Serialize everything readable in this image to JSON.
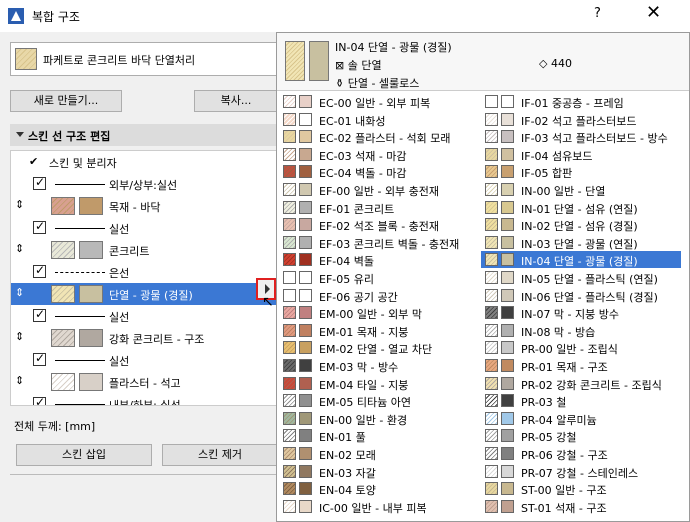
{
  "window": {
    "title": "복합 구조",
    "help": "?",
    "close": "✕"
  },
  "preset": {
    "label": "파케트로 콘크리트 바닥 단열처리"
  },
  "buttons": {
    "new": "새로 만들기...",
    "copy": "복사...",
    "insert_skin": "스킨 삽입",
    "remove_skin": "스킨 제거"
  },
  "editor": {
    "title": "스킨 선 구조 편집",
    "total_thickness": "전체 두께: [mm]"
  },
  "skins": [
    {
      "kind": "header",
      "label": "스킨 및 분리자"
    },
    {
      "kind": "line",
      "label": "외부/상부:실선"
    },
    {
      "kind": "skin",
      "label": "목재 - 바닥",
      "fill": "#d8a090",
      "fill2": "#c09a6a"
    },
    {
      "kind": "line",
      "label": "실선"
    },
    {
      "kind": "skin",
      "label": "콘크리트",
      "fill": "#e8e8d8",
      "fill2": "#b8b8b8"
    },
    {
      "kind": "line",
      "label": "은선",
      "dashed": true
    },
    {
      "kind": "skin",
      "label": "단열 - 광물 (경질)",
      "fill": "#f1e5b5",
      "fill2": "#c8c0a0",
      "selected": true
    },
    {
      "kind": "line",
      "label": "실선"
    },
    {
      "kind": "skin",
      "label": "강화 콘크리트 - 구조",
      "fill": "#e0d8d0",
      "fill2": "#b0a8a0"
    },
    {
      "kind": "line",
      "label": "실선"
    },
    {
      "kind": "skin",
      "label": "플라스터 - 석고",
      "fill": "#ffffff",
      "fill2": "#d8d0c8"
    },
    {
      "kind": "line",
      "label": "내부/하부: 실선"
    }
  ],
  "popup": {
    "current_name": "IN-04 단열 - 광물 (경질)",
    "current_pen": "솔 단열",
    "current_category": "단열 - 셀룰로스",
    "current_number": "440",
    "materials": [
      {
        "col": 0,
        "label": "EC-00 일반 - 외부 피복",
        "c1": "#ffffff",
        "c2": "#e8d0c8"
      },
      {
        "col": 0,
        "label": "EC-01 내화성",
        "c1": "#f4d8c8",
        "c2": "#ffffff"
      },
      {
        "col": 0,
        "label": "EC-02 플라스터 - 석회 모래",
        "c1": "#e8d8a0",
        "c2": "#e0c8a0"
      },
      {
        "col": 0,
        "label": "EC-03 석재 - 마감",
        "c1": "#ffffff",
        "c2": "#c8a890"
      },
      {
        "col": 0,
        "label": "EC-04 벽돌 - 마감",
        "c1": "#c05040",
        "c2": "#a06040"
      },
      {
        "col": 0,
        "label": "EF-00 일반 - 외부 충전재",
        "c1": "#ffffff",
        "c2": "#d0c8b0"
      },
      {
        "col": 0,
        "label": "EF-01 콘크리트",
        "c1": "#f0f0e0",
        "c2": "#b0b0b0"
      },
      {
        "col": 0,
        "label": "EF-02 석조 블록 - 충전재",
        "c1": "#e8c0b0",
        "c2": "#c8a8a0"
      },
      {
        "col": 0,
        "label": "EF-03 콘크리트 벽돌 - 충전재",
        "c1": "#d8e8d0",
        "c2": "#b0b0b0"
      },
      {
        "col": 0,
        "label": "EF-04 벽돌",
        "c1": "#d04030",
        "c2": "#a03020"
      },
      {
        "col": 0,
        "label": "EF-05 유리",
        "c1": "#ffffff",
        "c2": "#ffffff"
      },
      {
        "col": 0,
        "label": "EF-06 공기 공간",
        "c1": "#ffffff",
        "c2": "#ffffff"
      },
      {
        "col": 0,
        "label": "EM-00 일반 - 외부 막",
        "c1": "#e8a8a0",
        "c2": "#c08080"
      },
      {
        "col": 0,
        "label": "EM-01 목재 - 지붕",
        "c1": "#e09a80",
        "c2": "#c08060"
      },
      {
        "col": 0,
        "label": "EM-02 단열 - 열교 차단",
        "c1": "#e8c070",
        "c2": "#c8a060"
      },
      {
        "col": 0,
        "label": "EM-03 막 - 방수",
        "c1": "#6a6a6a",
        "c2": "#404040"
      },
      {
        "col": 0,
        "label": "EM-04 타일 - 지붕",
        "c1": "#c84838",
        "c2": "#b06050"
      },
      {
        "col": 0,
        "label": "EM-05 티타늄 아연",
        "c1": "#ffffff",
        "c2": "#909090"
      },
      {
        "col": 0,
        "label": "EN-00 일반 - 환경",
        "c1": "#a0b8a0",
        "c2": "#a09878"
      },
      {
        "col": 0,
        "label": "EN-01 풀",
        "c1": "#ffffff",
        "c2": "#808080"
      },
      {
        "col": 0,
        "label": "EN-02 모래",
        "c1": "#e0c8a0",
        "c2": "#b09070"
      },
      {
        "col": 0,
        "label": "EN-03 자갈",
        "c1": "#d0c090",
        "c2": "#907860"
      },
      {
        "col": 0,
        "label": "EN-04 토양",
        "c1": "#b08a60",
        "c2": "#806040"
      },
      {
        "col": 0,
        "label": "IC-00 일반 - 내부 피복",
        "c1": "#ffffff",
        "c2": "#e8d8c8"
      },
      {
        "col": 1,
        "label": "IF-01 중공층 - 프레임",
        "c1": "#ffffff",
        "c2": "#ffffff"
      },
      {
        "col": 1,
        "label": "IF-02 석고 플라스터보드",
        "c1": "#ffffff",
        "c2": "#e8e0d8"
      },
      {
        "col": 1,
        "label": "IF-03 석고 플라스터보드 - 방수",
        "c1": "#ffffff",
        "c2": "#c8c0c0"
      },
      {
        "col": 1,
        "label": "IF-04 섬유보드",
        "c1": "#e8d8a0",
        "c2": "#d0c0a0"
      },
      {
        "col": 1,
        "label": "IF-05 합판",
        "c1": "#e8c890",
        "c2": "#c8a070"
      },
      {
        "col": 1,
        "label": "IN-00 일반 - 단열",
        "c1": "#ffffff",
        "c2": "#d8d0b0"
      },
      {
        "col": 1,
        "label": "IN-01 단열 - 섬유 (연질)",
        "c1": "#f0e0a0",
        "c2": "#d8c890"
      },
      {
        "col": 1,
        "label": "IN-02 단열 - 섬유 (경질)",
        "c1": "#f0e0a0",
        "c2": "#c8b890"
      },
      {
        "col": 1,
        "label": "IN-03 단열 - 광물 (연질)",
        "c1": "#f1e5b5",
        "c2": "#c8c0a0"
      },
      {
        "col": 1,
        "label": "IN-04 단열 - 광물 (경질)",
        "c1": "#f1e5b5",
        "c2": "#c8c0a0",
        "selected": true
      },
      {
        "col": 1,
        "label": "IN-05 단열 - 플라스틱 (연질)",
        "c1": "#ffffff",
        "c2": "#e0d8c8"
      },
      {
        "col": 1,
        "label": "IN-06 단열 - 플라스틱 (경질)",
        "c1": "#ffffff",
        "c2": "#d0c8b8"
      },
      {
        "col": 1,
        "label": "IN-07 막 - 지붕 방수",
        "c1": "#808080",
        "c2": "#404040"
      },
      {
        "col": 1,
        "label": "IN-08 막 - 방습",
        "c1": "#ffffff",
        "c2": "#b0b0b0"
      },
      {
        "col": 1,
        "label": "PR-00 일반 - 조립식",
        "c1": "#ffffff",
        "c2": "#c8c8c8"
      },
      {
        "col": 1,
        "label": "PR-01 목재 - 구조",
        "c1": "#e8a880",
        "c2": "#c08a60"
      },
      {
        "col": 1,
        "label": "PR-02 강화 콘크리트 - 조립식",
        "c1": "#f0e0b0",
        "c2": "#b0a8a0"
      },
      {
        "col": 1,
        "label": "PR-03 철",
        "c1": "#ffffff",
        "c2": "#404040"
      },
      {
        "col": 1,
        "label": "PR-04 알루미늄",
        "c1": "#ffffff",
        "c2": "#a0c8e8"
      },
      {
        "col": 1,
        "label": "PR-05 강철",
        "c1": "#ffffff",
        "c2": "#a0a0a0"
      },
      {
        "col": 1,
        "label": "PR-06 강철 - 구조",
        "c1": "#ffffff",
        "c2": "#808080"
      },
      {
        "col": 1,
        "label": "PR-07 강철 - 스테인레스",
        "c1": "#ffffff",
        "c2": "#d8d8d8"
      },
      {
        "col": 1,
        "label": "ST-00 일반 - 구조",
        "c1": "#e8d8a0",
        "c2": "#c8b890"
      },
      {
        "col": 1,
        "label": "ST-01 석재 - 구조",
        "c1": "#e0c0b0",
        "c2": "#c0a090"
      }
    ]
  }
}
